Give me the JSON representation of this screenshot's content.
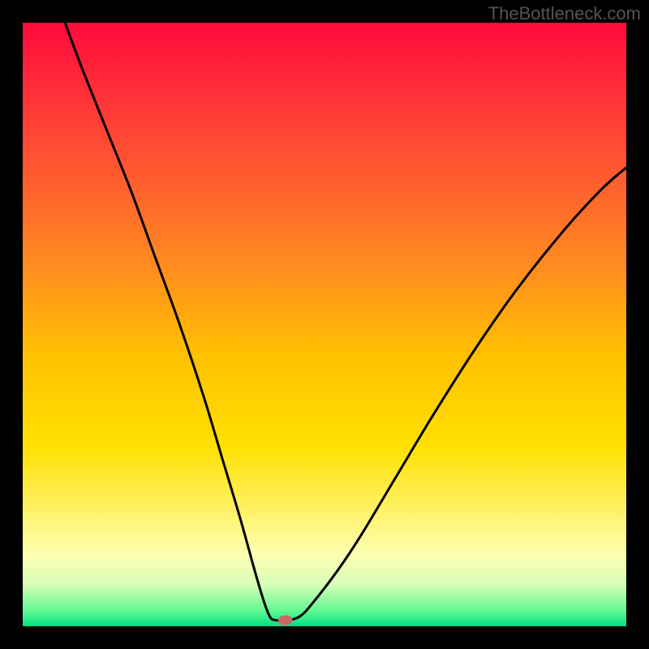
{
  "watermark": "TheBottleneck.com",
  "chart_data": {
    "type": "line",
    "title": "",
    "xlabel": "",
    "ylabel": "",
    "xlim": [
      0,
      100
    ],
    "ylim": [
      0,
      100
    ],
    "gradient_stops": [
      {
        "offset": 0.0,
        "color": "#ff0a3a"
      },
      {
        "offset": 0.1,
        "color": "#ff2a3a"
      },
      {
        "offset": 0.25,
        "color": "#ff5a30"
      },
      {
        "offset": 0.4,
        "color": "#ff8a20"
      },
      {
        "offset": 0.55,
        "color": "#ffc000"
      },
      {
        "offset": 0.7,
        "color": "#ffe000"
      },
      {
        "offset": 0.8,
        "color": "#fff060"
      },
      {
        "offset": 0.88,
        "color": "#fdffb0"
      },
      {
        "offset": 0.93,
        "color": "#d8ffb8"
      },
      {
        "offset": 0.975,
        "color": "#60f890"
      },
      {
        "offset": 1.0,
        "color": "#00e080"
      }
    ],
    "series": [
      {
        "name": "curve",
        "points": [
          {
            "x": 7.0,
            "y": 100.0
          },
          {
            "x": 10.0,
            "y": 92.0
          },
          {
            "x": 14.0,
            "y": 82.0
          },
          {
            "x": 18.0,
            "y": 72.0
          },
          {
            "x": 22.0,
            "y": 61.0
          },
          {
            "x": 26.0,
            "y": 50.0
          },
          {
            "x": 30.0,
            "y": 38.0
          },
          {
            "x": 33.0,
            "y": 28.0
          },
          {
            "x": 36.0,
            "y": 18.0
          },
          {
            "x": 38.5,
            "y": 9.0
          },
          {
            "x": 40.0,
            "y": 4.0
          },
          {
            "x": 41.0,
            "y": 1.5
          },
          {
            "x": 42.0,
            "y": 1.0
          },
          {
            "x": 44.0,
            "y": 1.0
          },
          {
            "x": 46.0,
            "y": 1.7
          },
          {
            "x": 48.0,
            "y": 3.8
          },
          {
            "x": 52.0,
            "y": 9.0
          },
          {
            "x": 56.0,
            "y": 15.0
          },
          {
            "x": 62.0,
            "y": 25.0
          },
          {
            "x": 68.0,
            "y": 35.0
          },
          {
            "x": 75.0,
            "y": 46.0
          },
          {
            "x": 82.0,
            "y": 56.0
          },
          {
            "x": 90.0,
            "y": 66.0
          },
          {
            "x": 96.0,
            "y": 72.5
          },
          {
            "x": 100.0,
            "y": 76.0
          }
        ]
      }
    ],
    "marker": {
      "x": 43.5,
      "y": 1.0,
      "color": "#cc6666",
      "rx": 9,
      "ry": 6
    }
  }
}
